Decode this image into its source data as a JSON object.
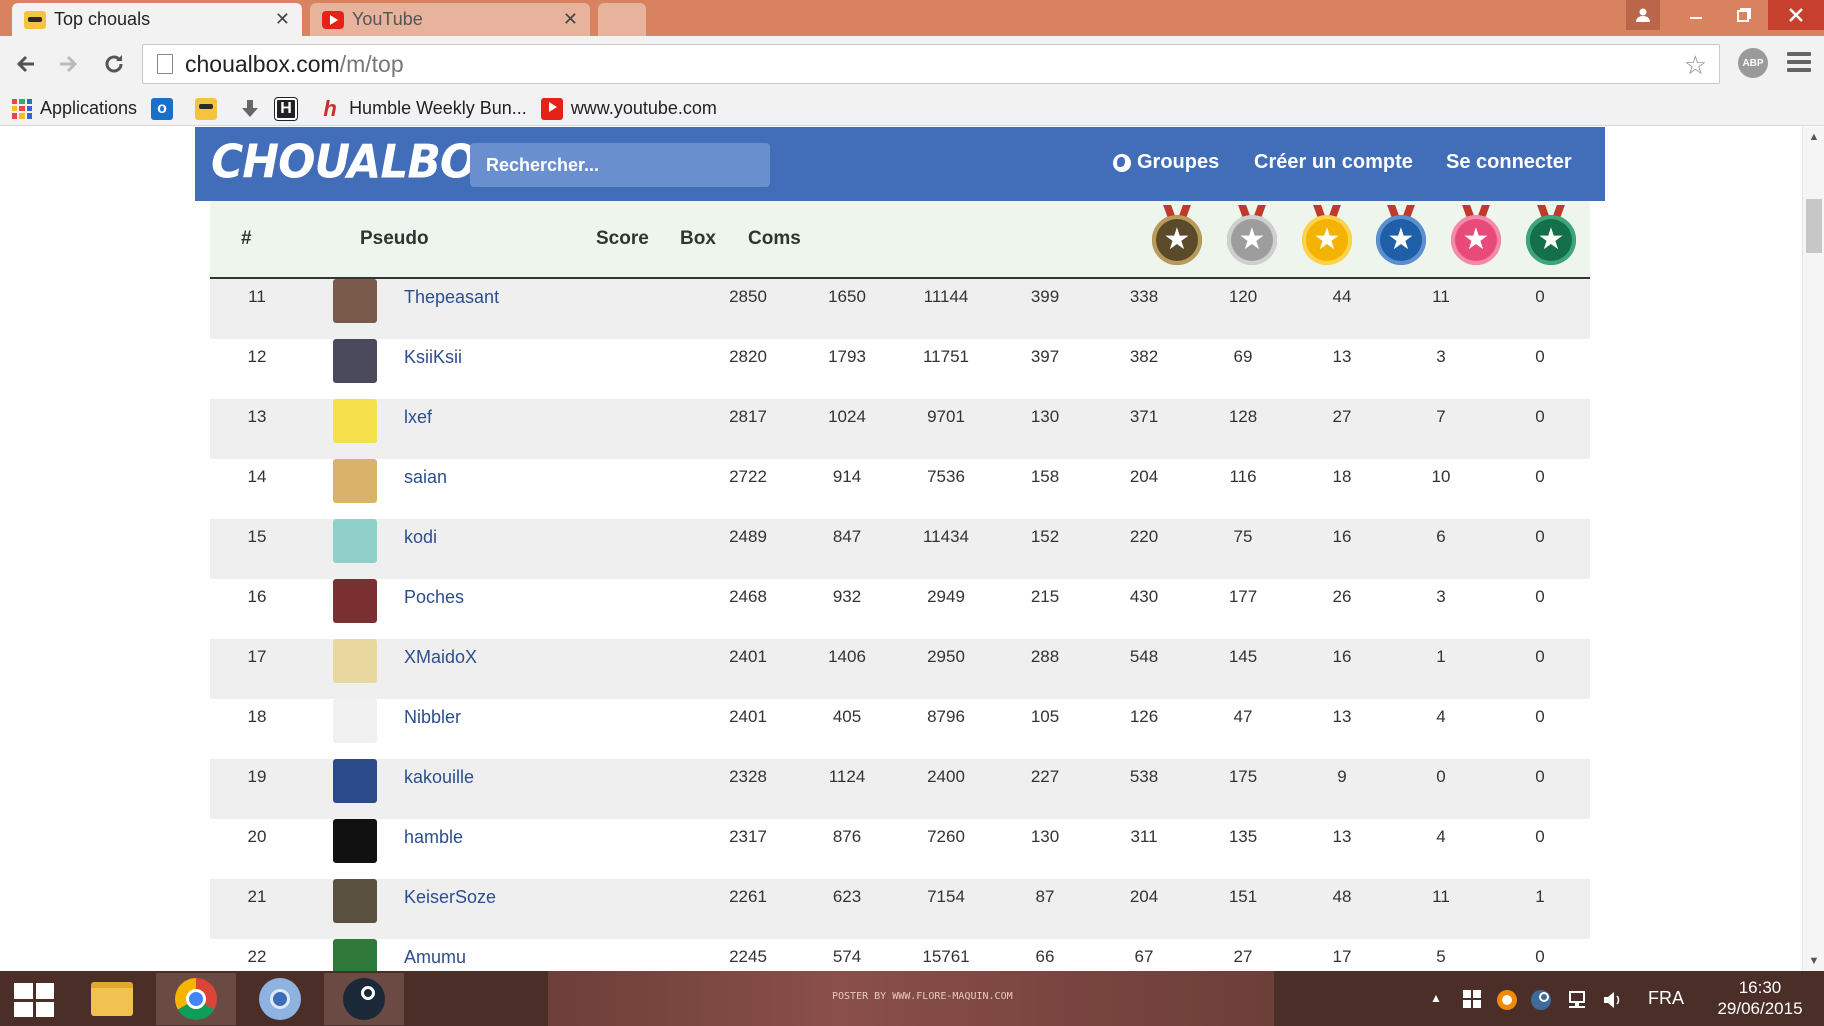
{
  "browser": {
    "tabs": [
      {
        "title": "Top chouals",
        "active": true
      },
      {
        "title": "YouTube",
        "active": false
      }
    ],
    "url_host": "choualbox.com",
    "url_path": "/m/top",
    "abp_label": "ABP",
    "bookmarks": [
      {
        "label": "Applications",
        "icon": "apps-icon"
      },
      {
        "label": "",
        "icon": "outlook-icon"
      },
      {
        "label": "",
        "icon": "choualbox-icon"
      },
      {
        "label": "",
        "icon": "download-icon"
      },
      {
        "label": "",
        "icon": "h-icon"
      },
      {
        "label": "Humble Weekly Bun...",
        "icon": "humble-icon"
      },
      {
        "label": "www.youtube.com",
        "icon": "youtube-icon"
      }
    ]
  },
  "site": {
    "logo": "CHOUALBOX",
    "search_placeholder": "Rechercher...",
    "nav": {
      "groups": "Groupes",
      "signup": "Créer un compte",
      "login": "Se connecter"
    }
  },
  "table": {
    "headers": {
      "rank": "#",
      "pseudo": "Pseudo",
      "score": "Score",
      "box": "Box",
      "coms": "Coms"
    },
    "medals": [
      {
        "name": "bronze-medal-icon",
        "color": "#5a4a2a",
        "ring": "#b99a5a"
      },
      {
        "name": "silver-medal-icon",
        "color": "#9d9d9d",
        "ring": "#cfcfcf"
      },
      {
        "name": "gold-medal-icon",
        "color": "#f3b300",
        "ring": "#ffd24d"
      },
      {
        "name": "blue-medal-icon",
        "color": "#1f5fa8",
        "ring": "#5a8fd0"
      },
      {
        "name": "pink-medal-icon",
        "color": "#e84a7a",
        "ring": "#f48aab"
      },
      {
        "name": "green-medal-icon",
        "color": "#13704a",
        "ring": "#3da57a"
      }
    ],
    "rows": [
      {
        "rank": "11",
        "pseudo": "Thepeasant",
        "c": [
          "2850",
          "1650",
          "11144",
          "399",
          "338",
          "120",
          "44",
          "11",
          "0"
        ],
        "avatar": "#7a5a4a"
      },
      {
        "rank": "12",
        "pseudo": "KsiiKsii",
        "c": [
          "2820",
          "1793",
          "11751",
          "397",
          "382",
          "69",
          "13",
          "3",
          "0"
        ],
        "avatar": "#4a4a5c"
      },
      {
        "rank": "13",
        "pseudo": "lxef",
        "c": [
          "2817",
          "1024",
          "9701",
          "130",
          "371",
          "128",
          "27",
          "7",
          "0"
        ],
        "avatar": "#f4e04a"
      },
      {
        "rank": "14",
        "pseudo": "saian",
        "c": [
          "2722",
          "914",
          "7536",
          "158",
          "204",
          "116",
          "18",
          "10",
          "0"
        ],
        "avatar": "#d9b36a"
      },
      {
        "rank": "15",
        "pseudo": "kodi",
        "c": [
          "2489",
          "847",
          "11434",
          "152",
          "220",
          "75",
          "16",
          "6",
          "0"
        ],
        "avatar": "#8fd0c8"
      },
      {
        "rank": "16",
        "pseudo": "Poches",
        "c": [
          "2468",
          "932",
          "2949",
          "215",
          "430",
          "177",
          "26",
          "3",
          "0"
        ],
        "avatar": "#7a3030"
      },
      {
        "rank": "17",
        "pseudo": "XMaidoX",
        "c": [
          "2401",
          "1406",
          "2950",
          "288",
          "548",
          "145",
          "16",
          "1",
          "0"
        ],
        "avatar": "#e8d8a0"
      },
      {
        "rank": "18",
        "pseudo": "Nibbler",
        "c": [
          "2401",
          "405",
          "8796",
          "105",
          "126",
          "47",
          "13",
          "4",
          "0"
        ],
        "avatar": "#f0f0f0"
      },
      {
        "rank": "19",
        "pseudo": "kakouille",
        "c": [
          "2328",
          "1124",
          "2400",
          "227",
          "538",
          "175",
          "9",
          "0",
          "0"
        ],
        "avatar": "#2a4a8a"
      },
      {
        "rank": "20",
        "pseudo": "hamble",
        "c": [
          "2317",
          "876",
          "7260",
          "130",
          "311",
          "135",
          "13",
          "4",
          "0"
        ],
        "avatar": "#111111"
      },
      {
        "rank": "21",
        "pseudo": "KeiserSoze",
        "c": [
          "2261",
          "623",
          "7154",
          "87",
          "204",
          "151",
          "48",
          "11",
          "1"
        ],
        "avatar": "#5a5040"
      },
      {
        "rank": "22",
        "pseudo": "Amumu",
        "c": [
          "2245",
          "574",
          "15761",
          "66",
          "67",
          "27",
          "17",
          "5",
          "0"
        ],
        "avatar": "#2f7a3a"
      }
    ]
  },
  "taskbar": {
    "language": "FRA",
    "time": "16:30",
    "date": "29/06/2015",
    "wallpaper_text": "POSTER BY WWW.FLORE-MAQUIN.COM"
  }
}
